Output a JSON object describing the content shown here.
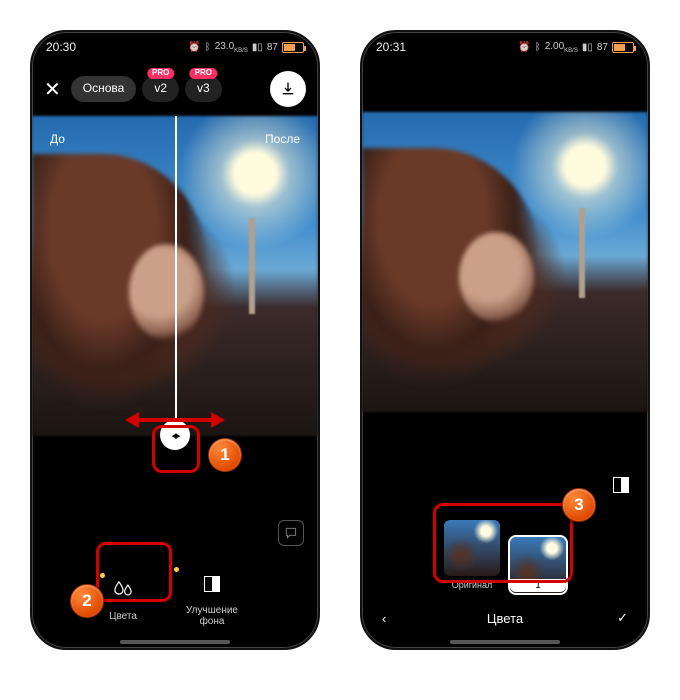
{
  "left": {
    "status": {
      "time": "20:30",
      "net": "23.0",
      "net_unit": "KB/S",
      "battery": "87"
    },
    "topbar": {
      "mode_main": "Основа",
      "v2": "v2",
      "v3": "v3",
      "pro": "PRO"
    },
    "before": "До",
    "after": "После",
    "tools": {
      "colors": "Цвета",
      "bg_enhance": "Улучшение фона"
    }
  },
  "right": {
    "status": {
      "time": "20:31",
      "net": "2.00",
      "net_unit": "KB/S",
      "battery": "87"
    },
    "variants": {
      "original": "Оригинал",
      "v1": "1"
    },
    "footer_title": "Цвета"
  },
  "annotations": {
    "n1": "1",
    "n2": "2",
    "n3": "3"
  }
}
